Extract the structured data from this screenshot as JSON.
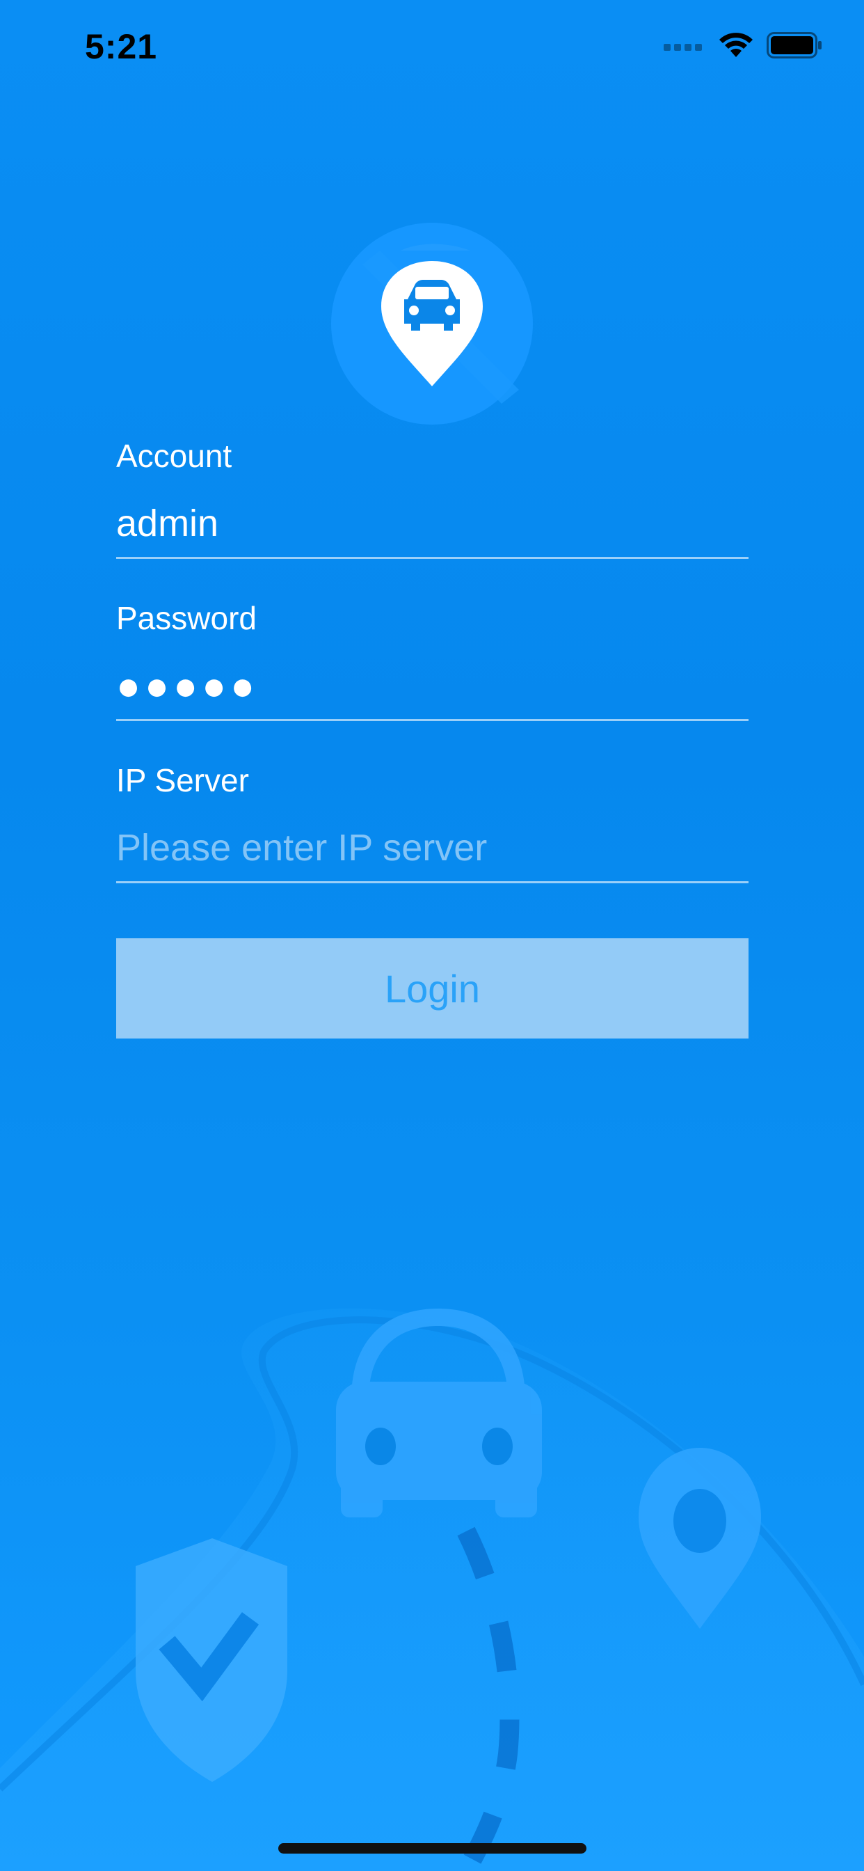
{
  "status_bar": {
    "time": "5:21",
    "icons": [
      "signal-icon",
      "wifi-icon",
      "battery-icon"
    ]
  },
  "logo": {
    "icon": "car-location-pin-icon"
  },
  "form": {
    "account": {
      "label": "Account",
      "value": "admin",
      "placeholder": ""
    },
    "password": {
      "label": "Password",
      "value": "●●●●●",
      "placeholder": ""
    },
    "ip_server": {
      "label": "IP Server",
      "value": "",
      "placeholder": "Please enter IP server"
    }
  },
  "login_button": {
    "label": "Login"
  },
  "colors": {
    "background": "#0a8ef4",
    "button_bg": "#93cbf7",
    "button_text": "#2aa2f8",
    "text": "#ffffff"
  },
  "background_art": {
    "icons": [
      "car-icon",
      "shield-check-icon",
      "location-pin-icon",
      "road-icon"
    ]
  }
}
